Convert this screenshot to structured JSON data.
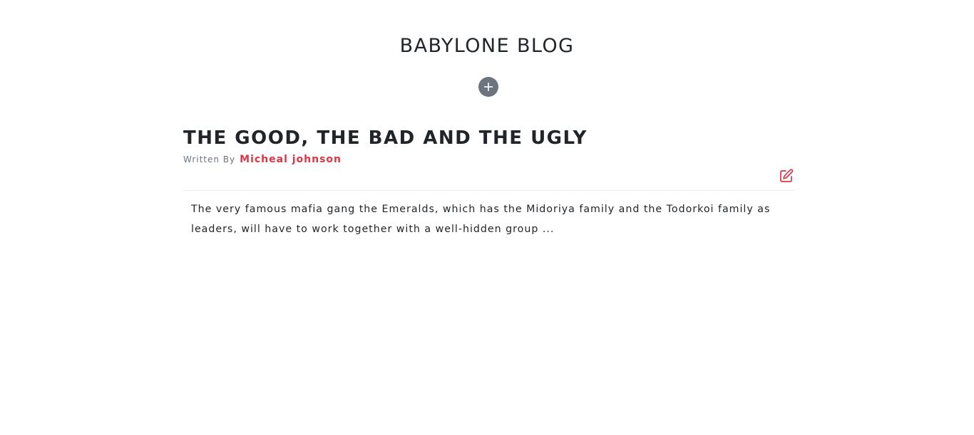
{
  "site": {
    "title": "BABYLONE BLOG"
  },
  "header": {
    "add_icon": "plus-circle-icon"
  },
  "post": {
    "title": "THE GOOD, THE BAD AND THE UGLY",
    "byline_label": "Written By",
    "author": "Micheal johnson",
    "edit_icon": "edit-icon",
    "excerpt": "The very famous mafia gang the Emeralds, which has the Midoriya family and the Todorkoi family as leaders, will have to work together with a well-hidden group ..."
  },
  "colors": {
    "accent": "#dc3545",
    "muted": "#6c757d",
    "text": "#212529"
  }
}
